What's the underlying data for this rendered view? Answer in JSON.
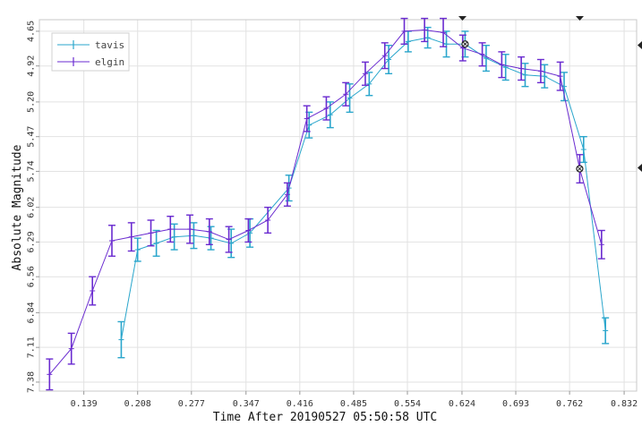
{
  "chart_data": {
    "type": "line",
    "title": "",
    "xlabel": "Time After 20190527 05:50:58 UTC",
    "ylabel": "Absolute Magnitude",
    "x_ticks": [
      "0.139",
      "0.208",
      "0.277",
      "0.347",
      "0.416",
      "0.485",
      "0.554",
      "0.624",
      "0.693",
      "0.762",
      "0.832"
    ],
    "y_ticks": [
      "4.65",
      "4.92",
      "5.20",
      "5.47",
      "5.74",
      "6.02",
      "6.29",
      "6.56",
      "6.84",
      "7.11",
      "7.38"
    ],
    "xlim": [
      0.082,
      0.848
    ],
    "ylim": [
      7.45,
      4.56
    ],
    "y_inverted": true,
    "grid": true,
    "legend": "top-left",
    "series": [
      {
        "name": "tavis",
        "color": "#2aa6cc",
        "points": [
          {
            "x": 0.187,
            "y": 7.05,
            "err": 0.14
          },
          {
            "x": 0.208,
            "y": 6.35,
            "err": 0.09
          },
          {
            "x": 0.232,
            "y": 6.3,
            "err": 0.1
          },
          {
            "x": 0.255,
            "y": 6.25,
            "err": 0.1
          },
          {
            "x": 0.28,
            "y": 6.24,
            "err": 0.1
          },
          {
            "x": 0.302,
            "y": 6.26,
            "err": 0.09
          },
          {
            "x": 0.328,
            "y": 6.3,
            "err": 0.11
          },
          {
            "x": 0.352,
            "y": 6.22,
            "err": 0.11
          },
          {
            "x": 0.402,
            "y": 5.87,
            "err": 0.1
          },
          {
            "x": 0.428,
            "y": 5.38,
            "err": 0.1
          },
          {
            "x": 0.455,
            "y": 5.3,
            "err": 0.1
          },
          {
            "x": 0.48,
            "y": 5.17,
            "err": 0.11
          },
          {
            "x": 0.505,
            "y": 5.06,
            "err": 0.09
          },
          {
            "x": 0.53,
            "y": 4.87,
            "err": 0.11
          },
          {
            "x": 0.555,
            "y": 4.73,
            "err": 0.08
          },
          {
            "x": 0.58,
            "y": 4.7,
            "err": 0.08
          },
          {
            "x": 0.604,
            "y": 4.75,
            "err": 0.1
          },
          {
            "x": 0.628,
            "y": 4.75,
            "err": 0.1
          },
          {
            "x": 0.655,
            "y": 4.86,
            "err": 0.1
          },
          {
            "x": 0.68,
            "y": 4.93,
            "err": 0.1
          },
          {
            "x": 0.705,
            "y": 4.99,
            "err": 0.09
          },
          {
            "x": 0.73,
            "y": 5.0,
            "err": 0.09
          },
          {
            "x": 0.755,
            "y": 5.08,
            "err": 0.11
          },
          {
            "x": 0.78,
            "y": 5.57,
            "err": 0.1
          },
          {
            "x": 0.808,
            "y": 6.98,
            "err": 0.1
          }
        ]
      },
      {
        "name": "elgin",
        "color": "#6a2bd0",
        "points": [
          {
            "x": 0.095,
            "y": 7.32,
            "err": 0.12
          },
          {
            "x": 0.123,
            "y": 7.12,
            "err": 0.12
          },
          {
            "x": 0.15,
            "y": 6.67,
            "err": 0.11
          },
          {
            "x": 0.175,
            "y": 6.28,
            "err": 0.12
          },
          {
            "x": 0.2,
            "y": 6.25,
            "err": 0.11
          },
          {
            "x": 0.225,
            "y": 6.22,
            "err": 0.1
          },
          {
            "x": 0.25,
            "y": 6.19,
            "err": 0.1
          },
          {
            "x": 0.275,
            "y": 6.19,
            "err": 0.11
          },
          {
            "x": 0.3,
            "y": 6.21,
            "err": 0.1
          },
          {
            "x": 0.325,
            "y": 6.27,
            "err": 0.1
          },
          {
            "x": 0.35,
            "y": 6.2,
            "err": 0.09
          },
          {
            "x": 0.375,
            "y": 6.12,
            "err": 0.1
          },
          {
            "x": 0.4,
            "y": 5.92,
            "err": 0.09
          },
          {
            "x": 0.425,
            "y": 5.33,
            "err": 0.1
          },
          {
            "x": 0.45,
            "y": 5.25,
            "err": 0.09
          },
          {
            "x": 0.475,
            "y": 5.14,
            "err": 0.09
          },
          {
            "x": 0.5,
            "y": 4.98,
            "err": 0.09
          },
          {
            "x": 0.525,
            "y": 4.84,
            "err": 0.1
          },
          {
            "x": 0.55,
            "y": 4.65,
            "err": 0.1
          },
          {
            "x": 0.576,
            "y": 4.64,
            "err": 0.09
          },
          {
            "x": 0.6,
            "y": 4.66,
            "err": 0.11
          },
          {
            "x": 0.625,
            "y": 4.78,
            "err": 0.1
          },
          {
            "x": 0.65,
            "y": 4.83,
            "err": 0.09
          },
          {
            "x": 0.675,
            "y": 4.91,
            "err": 0.1
          },
          {
            "x": 0.7,
            "y": 4.94,
            "err": 0.09
          },
          {
            "x": 0.725,
            "y": 4.96,
            "err": 0.09
          },
          {
            "x": 0.75,
            "y": 5.0,
            "err": 0.11
          },
          {
            "x": 0.775,
            "y": 5.72,
            "err": 0.11
          },
          {
            "x": 0.803,
            "y": 6.31,
            "err": 0.11
          }
        ]
      }
    ],
    "highlighted_points": [
      {
        "series": "tavis",
        "x": 0.628,
        "y": 4.75
      },
      {
        "series": "elgin",
        "x": 0.775,
        "y": 5.72
      }
    ]
  }
}
